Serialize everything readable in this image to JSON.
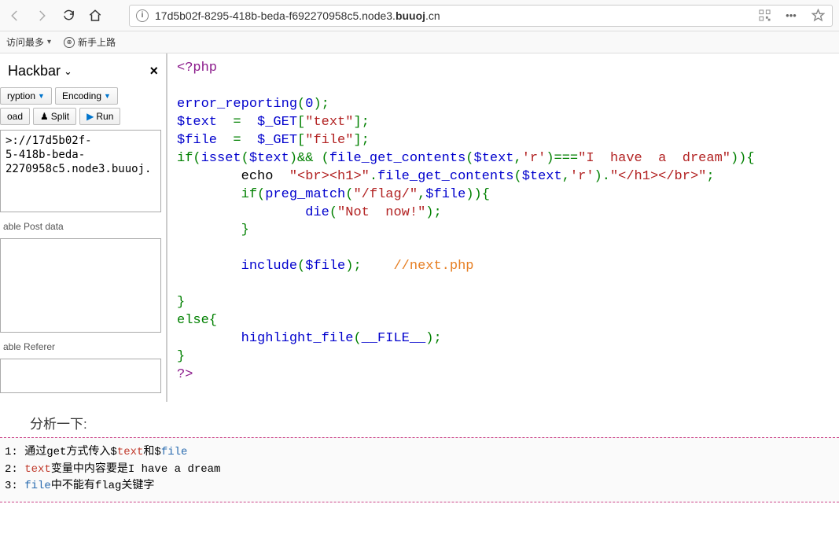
{
  "url": {
    "prefix": "17d5b02f-8295-418b-beda-f692270958c5.node3.",
    "bold": "buuoj",
    "suffix": ".cn"
  },
  "bookmarks": {
    "most": "访问最多",
    "new": "新手上路"
  },
  "hackbar": {
    "title": "Hackbar",
    "encryption": "ryption",
    "encoding": "Encoding",
    "load": "oad",
    "split": "Split",
    "run": "Run",
    "url_text": ">://17d5b02f-\n5-418b-beda-\n2270958c5.node3.buuoj.",
    "post_label": "able Post data",
    "referer_label": "able Referer"
  },
  "code": {
    "l1": "<?php",
    "l3a": "error_reporting",
    "l3b": "(",
    "l3c": "0",
    "l3d": ");",
    "l4a": "$text",
    "l4b": "  =  ",
    "l4c": "$_GET",
    "l4d": "[",
    "l4e": "\"text\"",
    "l4f": "];",
    "l5a": "$file",
    "l5b": "  =  ",
    "l5c": "$_GET",
    "l5d": "[",
    "l5e": "\"file\"",
    "l5f": "];",
    "l6a": "if",
    "l6b": "(",
    "l6c": "isset",
    "l6d": "(",
    "l6e": "$text",
    "l6f": ")&& (",
    "l6g": "file_get_contents",
    "l6h": "(",
    "l6i": "$text",
    "l6j": ",",
    "l6k": "'r'",
    "l6l": ")===",
    "l6m": "\"I  have  a  dream\"",
    "l6n": ")){",
    "l7a": "        echo  ",
    "l7b": "\"<br><h1>\"",
    "l7c": ".",
    "l7d": "file_get_contents",
    "l7e": "(",
    "l7f": "$text",
    "l7g": ",",
    "l7h": "'r'",
    "l7i": ").",
    "l7j": "\"</h1></br>\"",
    "l7k": ";",
    "l8a": "        if",
    "l8b": "(",
    "l8c": "preg_match",
    "l8d": "(",
    "l8e": "\"/flag/\"",
    "l8f": ",",
    "l8g": "$file",
    "l8h": ")){",
    "l9a": "                die",
    "l9b": "(",
    "l9c": "\"Not  now!\"",
    "l9d": ");",
    "l10": "        }",
    "l12a": "        include",
    "l12b": "(",
    "l12c": "$file",
    "l12d": "); ",
    "l12e": "   //next.php",
    "l14": "}",
    "l15": "else{",
    "l16a": "        highlight_file",
    "l16b": "(",
    "l16c": "__FILE__",
    "l16d": ");",
    "l17": "}",
    "l18": "?>"
  },
  "analysis": {
    "head": "分析一下:",
    "line1_a": "1: 通过get方式传入$",
    "line1_b": "text",
    "line1_c": "和$",
    "line1_d": "file",
    "line2_a": "2: ",
    "line2_b": "text",
    "line2_c": "变量中内容要是I have a dream",
    "line3_a": "3: ",
    "line3_b": "file",
    "line3_c": "中不能有flag关键字"
  }
}
